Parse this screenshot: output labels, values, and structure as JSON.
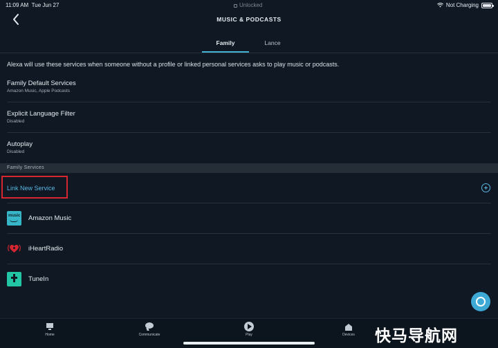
{
  "status_bar": {
    "time": "11:09 AM",
    "date": "Tue Jun 27",
    "center_text": "Unlocked",
    "right_text": "Not Charging"
  },
  "header": {
    "title": "MUSIC & PODCASTS",
    "back_icon": "chevron-left-icon"
  },
  "tabs": [
    {
      "label": "Family",
      "selected": true
    },
    {
      "label": "Lance",
      "selected": false
    }
  ],
  "intro": "Alexa will use these services when someone without a profile or linked personal services asks to play music or podcasts.",
  "settings": [
    {
      "title": "Family Default Services",
      "subtitle": "Amazon Music, Apple Podcasts"
    },
    {
      "title": "Explicit Language Filter",
      "subtitle": "Disabled"
    },
    {
      "title": "Autoplay",
      "subtitle": "Disabled"
    }
  ],
  "family_services": {
    "section_title": "Family Services",
    "link_label": "Link New Service",
    "services": [
      {
        "name": "Amazon Music",
        "logo_text": "music",
        "icon": "amazon-music-icon"
      },
      {
        "name": "iHeartRadio",
        "icon": "iheartradio-icon"
      },
      {
        "name": "TuneIn",
        "icon": "tunein-icon"
      }
    ]
  },
  "bottom_nav": [
    {
      "label": "Home",
      "icon": "home-icon"
    },
    {
      "label": "Communicate",
      "icon": "chat-icon"
    },
    {
      "label": "Play",
      "icon": "play-icon"
    },
    {
      "label": "Devices",
      "icon": "devices-icon"
    }
  ],
  "watermark": "快马导航网",
  "colors": {
    "background": "#0f1823",
    "accent": "#43b2d4",
    "link": "#5ab8e4",
    "highlight_border": "#d7262d"
  }
}
